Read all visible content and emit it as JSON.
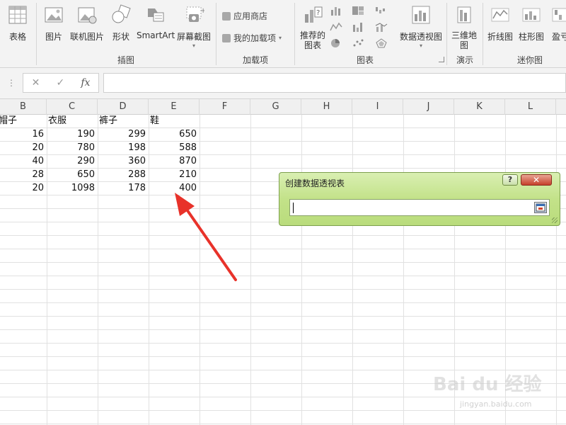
{
  "ribbon": {
    "buttons": {
      "table": "表格",
      "picture": "图片",
      "online_picture": "联机图片",
      "shapes": "形状",
      "smartart": "SmartArt",
      "screenshot": "屏幕截图",
      "app_store": "应用商店",
      "my_addins": "我的加载项",
      "recommended_charts": "推荐的\n图表",
      "pivot_chart": "数据透视图",
      "map_3d": "三维地\n图",
      "line_sparkline": "折线图",
      "column_sparkline": "柱形图",
      "winloss_sparkline": "盈亏"
    },
    "groups": {
      "illustrations": "插图",
      "addins": "加载项",
      "charts": "图表",
      "tours": "演示",
      "sparklines": "迷你图"
    }
  },
  "formula_bar": {
    "cancel": "✕",
    "enter": "✓",
    "fx": "fx",
    "value": ""
  },
  "columns": [
    "B",
    "C",
    "D",
    "E",
    "F",
    "G",
    "H",
    "I",
    "J",
    "K",
    "L"
  ],
  "table": {
    "headers": [
      "帽子",
      "衣服",
      "裤子",
      "鞋"
    ],
    "rows": [
      [
        "16",
        "190",
        "299",
        "650"
      ],
      [
        "20",
        "780",
        "198",
        "588"
      ],
      [
        "40",
        "290",
        "360",
        "870"
      ],
      [
        "28",
        "650",
        "288",
        "210"
      ],
      [
        "20",
        "1098",
        "178",
        "400"
      ]
    ]
  },
  "dialog": {
    "title": "创建数据透视表",
    "help": "?",
    "close": "✕",
    "range_value": ""
  },
  "watermark": {
    "text": "Bai du 经验",
    "url": "jingyan.baidu.com"
  },
  "colors": {
    "dialog_green": "#c3e289",
    "arrow_red": "#e8322a",
    "ribbon_bg": "#f3f3f3"
  }
}
